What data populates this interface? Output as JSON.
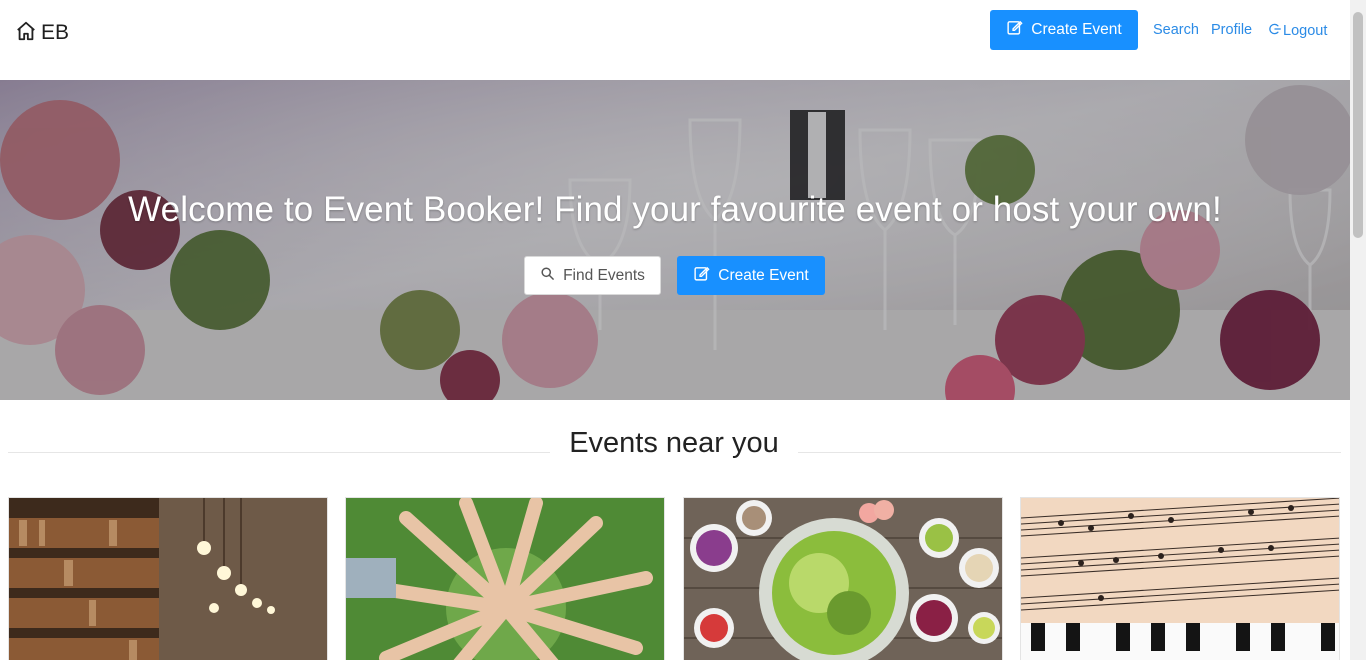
{
  "header": {
    "brand": "EB",
    "create_event_label": "Create Event",
    "links": {
      "search": "Search",
      "profile": "Profile",
      "logout": "Logout"
    }
  },
  "hero": {
    "title": "Welcome to Event Booker! Find your favourite event or host your own!",
    "find_events_label": "Find Events",
    "create_event_label": "Create Event"
  },
  "section": {
    "title": "Events near you"
  },
  "cards": [
    {
      "theme": "library-bookshelves"
    },
    {
      "theme": "hands-circle-on-grass"
    },
    {
      "theme": "salad-and-vegetables"
    },
    {
      "theme": "sheet-music-and-piano"
    }
  ],
  "colors": {
    "primary": "#1890ff",
    "link": "#2b8be6",
    "text": "#222222"
  },
  "icons": [
    "home-icon",
    "edit-icon",
    "search-icon",
    "logout-icon"
  ]
}
